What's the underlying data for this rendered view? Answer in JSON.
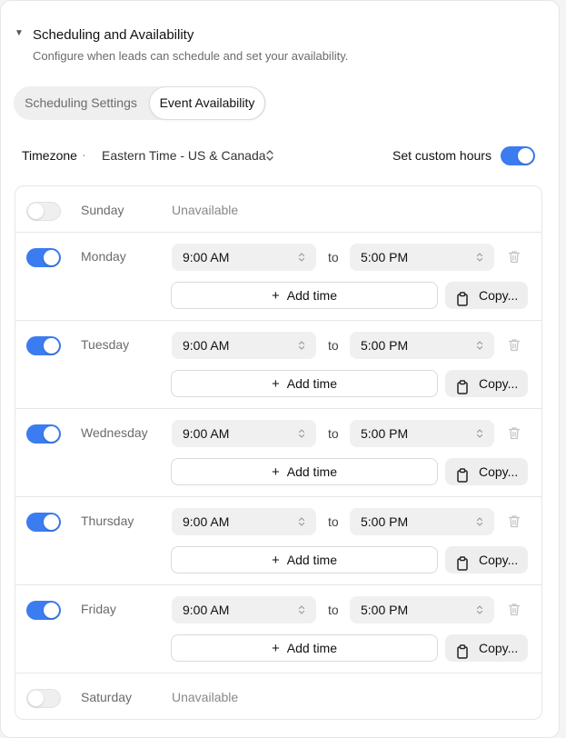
{
  "section": {
    "title": "Scheduling and Availability",
    "subtitle": "Configure when leads can schedule and set your availability."
  },
  "tabs": [
    {
      "label": "Scheduling Settings",
      "active": false
    },
    {
      "label": "Event Availability",
      "active": true
    }
  ],
  "timezone": {
    "label": "Timezone",
    "separator": "·",
    "value": "Eastern Time - US & Canada"
  },
  "custom_hours": {
    "label": "Set custom hours",
    "enabled": true
  },
  "colors": {
    "accent": "#3b7cf0",
    "toggle_off": "#efefef",
    "select_bg": "#f0f0f0"
  },
  "days": [
    {
      "name": "Sunday",
      "enabled": false,
      "status": "Unavailable"
    },
    {
      "name": "Monday",
      "enabled": true,
      "start": "9:00 AM",
      "to": "to",
      "end": "5:00 PM",
      "add_label": "Add time",
      "copy_label": "Copy..."
    },
    {
      "name": "Tuesday",
      "enabled": true,
      "start": "9:00 AM",
      "to": "to",
      "end": "5:00 PM",
      "add_label": "Add time",
      "copy_label": "Copy..."
    },
    {
      "name": "Wednesday",
      "enabled": true,
      "start": "9:00 AM",
      "to": "to",
      "end": "5:00 PM",
      "add_label": "Add time",
      "copy_label": "Copy..."
    },
    {
      "name": "Thursday",
      "enabled": true,
      "start": "9:00 AM",
      "to": "to",
      "end": "5:00 PM",
      "add_label": "Add time",
      "copy_label": "Copy..."
    },
    {
      "name": "Friday",
      "enabled": true,
      "start": "9:00 AM",
      "to": "to",
      "end": "5:00 PM",
      "add_label": "Add time",
      "copy_label": "Copy..."
    },
    {
      "name": "Saturday",
      "enabled": false,
      "status": "Unavailable"
    }
  ],
  "icons": {
    "collapse": "caret-down-icon",
    "select": "chevron-up-down-icon",
    "delete": "trash-icon",
    "add": "plus-icon",
    "copy": "clipboard-icon"
  }
}
